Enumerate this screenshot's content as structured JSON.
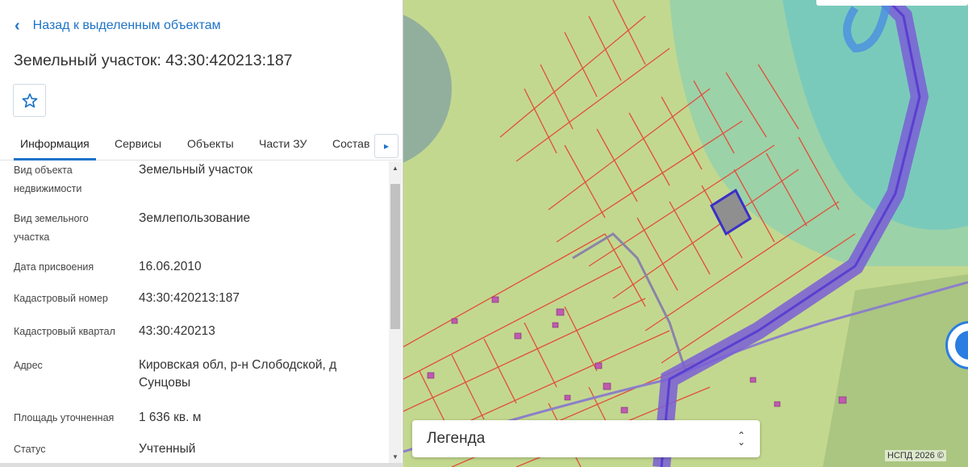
{
  "nav": {
    "back_label": "Назад к выделенным объектам"
  },
  "object": {
    "title": "Земельный участок: 43:30:420213:187"
  },
  "tabs": [
    {
      "label": "Информация",
      "active": true
    },
    {
      "label": "Сервисы",
      "active": false
    },
    {
      "label": "Объекты",
      "active": false
    },
    {
      "label": "Части ЗУ",
      "active": false
    },
    {
      "label": "Состав",
      "active": false
    }
  ],
  "info": [
    {
      "label": "Вид объекта недвижимости",
      "value": "Земельный участок"
    },
    {
      "label": "Вид земельного участка",
      "value": "Землепользование"
    },
    {
      "label": "Дата присвоения",
      "value": "16.06.2010"
    },
    {
      "label": "Кадастровый номер",
      "value": "43:30:420213:187"
    },
    {
      "label": "Кадастровый квартал",
      "value": "43:30:420213"
    },
    {
      "label": "Адрес",
      "value": "Кировская обл, р-н Слободской, д Сунцовы"
    },
    {
      "label": "Площадь уточненная",
      "value": "1 636 кв. м"
    },
    {
      "label": "Статус",
      "value": "Учтенный"
    }
  ],
  "map": {
    "legend_label": "Легенда",
    "copyright": "НСПД 2026 ©",
    "colors": {
      "base_field": "#c3d88f",
      "forest_zone": "#8fd0b0",
      "water_zone": "#6cc6c4",
      "parcel_lines": "#e0503a",
      "road": "#7a5fd6",
      "selected_parcel": "#3a2fc9",
      "building": "#c05ab0"
    }
  },
  "icons": {
    "back": "chevron-left-icon",
    "favorite": "star-outline-icon",
    "tabs_next": "chevron-right-icon",
    "legend_toggle": "chevron-up-down-icon",
    "geolocation": "location-icon"
  }
}
